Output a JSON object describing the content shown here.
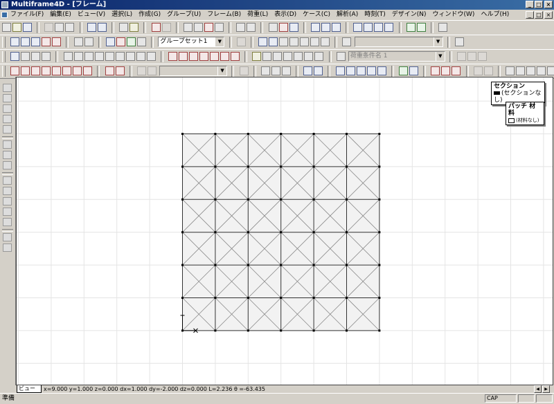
{
  "window": {
    "title": "Multiframe4D - [フレーム]"
  },
  "menu": [
    "ファイル(F)",
    "編集(E)",
    "ビュー(V)",
    "選択(L)",
    "作成(G)",
    "グループ(U)",
    "フレーム(B)",
    "荷重(L)",
    "表示(D)",
    "ケース(C)",
    "解析(A)",
    "時刻(T)",
    "デザイン(N)",
    "ウィンドウ(W)",
    "ヘルプ(H)"
  ],
  "toolbar": {
    "group_set": "グループセット1",
    "load_case": "荷重条件名 1"
  },
  "legend_section": {
    "title": "セクション",
    "value": "(セクションなし)"
  },
  "legend_patch": {
    "title": "パッチ 材料",
    "value": "(材料なし)"
  },
  "view_tab": "ビュー",
  "coords": "x=9.000 y=1.000 z=0.000 dx=1.000 dy=-2.000 dz=0.000 L=2.236  θ =-63.435",
  "status": {
    "text": "準備",
    "cap": "CAP"
  },
  "frame": {
    "cols": 6,
    "rows": 6
  }
}
